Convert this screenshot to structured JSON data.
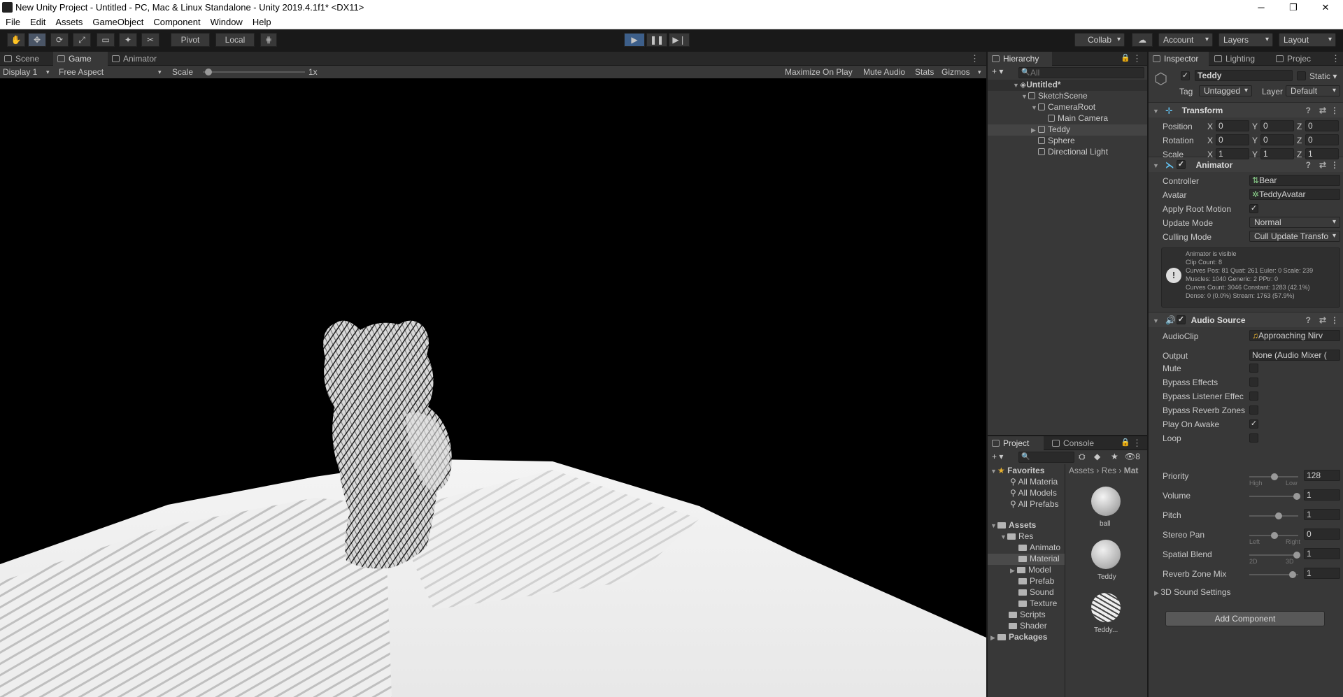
{
  "window": {
    "title": "New Unity Project - Untitled - PC, Mac & Linux Standalone - Unity 2019.4.1f1* <DX11>",
    "minimize": "─",
    "maximize": "❐",
    "close": "✕"
  },
  "menu": [
    "File",
    "Edit",
    "Assets",
    "GameObject",
    "Component",
    "Window",
    "Help"
  ],
  "toolbar": {
    "pivot": "Pivot",
    "local": "Local",
    "collab": "Collab",
    "account": "Account",
    "layers": "Layers",
    "layout": "Layout"
  },
  "game_panel": {
    "tabs": [
      "Scene",
      "Game",
      "Animator"
    ],
    "display": "Display 1",
    "aspect": "Free Aspect",
    "scale_label": "Scale",
    "scale_value": "1x",
    "scale_fraction": 0.02,
    "maximize_on_play": "Maximize On Play",
    "mute_audio": "Mute Audio",
    "stats": "Stats",
    "gizmos": "Gizmos"
  },
  "hierarchy": {
    "tab": "Hierarchy",
    "search_placeholder": "All",
    "scene": "Untitled*",
    "items": [
      "SketchScene",
      "CameraRoot",
      "Main Camera",
      "Teddy",
      "Sphere",
      "Directional Light"
    ]
  },
  "project": {
    "tabs": [
      "Project",
      "Console"
    ],
    "hidden_count": "8",
    "favorites": "Favorites",
    "fav_items": [
      "All Materia",
      "All Models",
      "All Prefabs"
    ],
    "assets": "Assets",
    "res": "Res",
    "res_children": [
      "Animato",
      "Material",
      "Model",
      "Prefab",
      "Sound",
      "Texture"
    ],
    "asset_folders": [
      "Scripts",
      "Shader"
    ],
    "packages": "Packages",
    "breadcrumb": [
      "Assets",
      "Res",
      "Mat"
    ],
    "thumbs": [
      "ball",
      "Teddy",
      "Teddy..."
    ]
  },
  "inspector": {
    "tabs": [
      "Inspector",
      "Lighting",
      "Projec"
    ],
    "object_name": "Teddy",
    "static": "Static",
    "tag_label": "Tag",
    "tag": "Untagged",
    "layer_label": "Layer",
    "layer": "Default",
    "transform": {
      "title": "Transform",
      "rows": [
        {
          "label": "Position",
          "x": "0",
          "y": "0",
          "z": "0"
        },
        {
          "label": "Rotation",
          "x": "0",
          "y": "0",
          "z": "0"
        },
        {
          "label": "Scale",
          "x": "1",
          "y": "1",
          "z": "1"
        }
      ]
    },
    "animator": {
      "title": "Animator",
      "controller_label": "Controller",
      "controller": "Bear",
      "avatar_label": "Avatar",
      "avatar": "TeddyAvatar",
      "apply_root_motion": "Apply Root Motion",
      "update_mode_label": "Update Mode",
      "update_mode": "Normal",
      "culling_mode_label": "Culling Mode",
      "culling_mode": "Cull Update Transfo",
      "info": [
        "Animator is visible",
        "Clip Count: 8",
        "Curves Pos: 81 Quat: 261 Euler: 0 Scale: 239",
        "Muscles: 1040 Generic: 2 PPtr: 0",
        "Curves Count: 3046 Constant: 1283 (42.1%)",
        "Dense: 0 (0.0%) Stream: 1763 (57.9%)"
      ]
    },
    "audio": {
      "title": "Audio Source",
      "clip_label": "AudioClip",
      "clip": "Approaching Nirv",
      "output_label": "Output",
      "output": "None (Audio Mixer (",
      "checks": [
        {
          "label": "Mute",
          "checked": false
        },
        {
          "label": "Bypass Effects",
          "checked": false
        },
        {
          "label": "Bypass Listener Effec",
          "checked": false
        },
        {
          "label": "Bypass Reverb Zones",
          "checked": false
        },
        {
          "label": "Play On Awake",
          "checked": true
        },
        {
          "label": "Loop",
          "checked": false
        }
      ],
      "sliders": [
        {
          "label": "Priority",
          "value": "128",
          "fraction": 0.5,
          "left": "High",
          "right": "Low"
        },
        {
          "label": "Volume",
          "value": "1",
          "fraction": 1.0
        },
        {
          "label": "Pitch",
          "value": "1",
          "fraction": 0.6
        },
        {
          "label": "Stereo Pan",
          "value": "0",
          "fraction": 0.5,
          "left": "Left",
          "right": "Right"
        },
        {
          "label": "Spatial Blend",
          "value": "1",
          "fraction": 1.0,
          "left": "2D",
          "right": "3D"
        },
        {
          "label": "Reverb Zone Mix",
          "value": "1",
          "fraction": 0.9
        }
      ],
      "sound_settings": "3D Sound Settings"
    },
    "add_component": "Add Component"
  },
  "colors": {
    "accent": "#3d5f8a",
    "panel": "#383838",
    "dark": "#282828"
  }
}
